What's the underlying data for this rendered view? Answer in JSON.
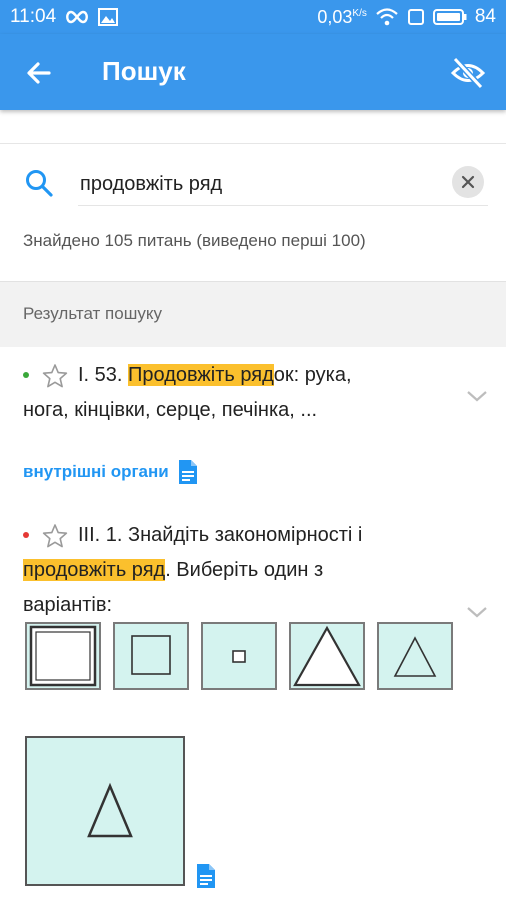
{
  "status_bar": {
    "time": "11:04",
    "speed": "0,03",
    "speed_unit": "K/s",
    "battery": "84",
    "icons": [
      "infinity-icon",
      "image-icon",
      "wifi-icon",
      "square-icon",
      "battery-icon"
    ]
  },
  "app_bar": {
    "title": "Пошук",
    "back_icon": "arrow-left-icon",
    "visibility_icon": "eye-off-icon",
    "color": "#3a97ec"
  },
  "search": {
    "value": "продовжіть ряд",
    "icon": "search-icon",
    "clear_icon": "close-icon",
    "found_text": "Знайдено 105 питань (виведено перші 100)"
  },
  "section_header": "Результат пошуку",
  "results": [
    {
      "status_color": "#3aa83a",
      "prefix": "I. 53. ",
      "highlight": "Продовжіть ряд",
      "rest_line1": "ок: рука,",
      "line2": "нога, кінцівки, серце, печінка, ...",
      "topic": "внутрішні органи"
    },
    {
      "status_color": "#e53935",
      "line1": "III. 1. Знайдіть закономірності і",
      "highlight": "продовжіть ряд",
      "rest_line2": ". Виберіть один з",
      "line3": "варіантів:"
    }
  ],
  "colors": {
    "highlight": "#fbc02d",
    "link": "#2196f3",
    "thumb_bg": "#d4f3ef"
  }
}
